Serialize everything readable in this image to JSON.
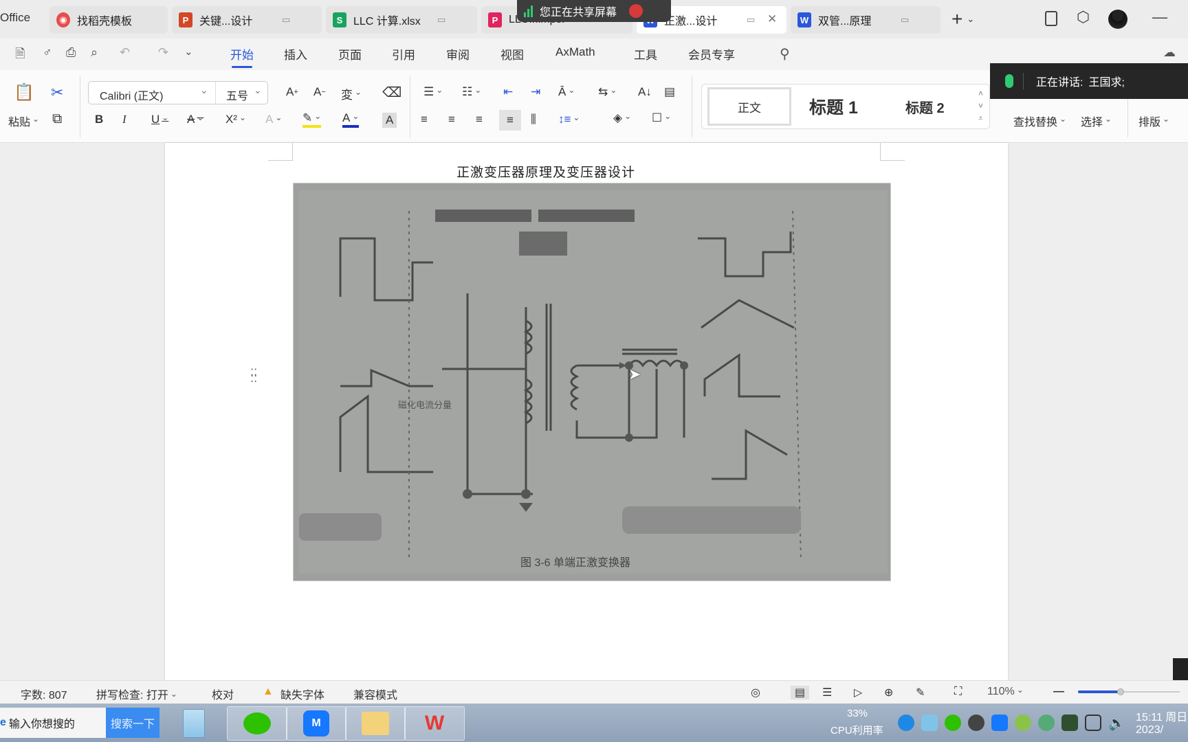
{
  "tabs": [
    {
      "label": "Office",
      "icon": "office-logo"
    },
    {
      "label": "找稻壳模板",
      "icon": "docer-icon",
      "color": "#e74c4c"
    },
    {
      "label": "关键...设计",
      "icon": "ppt-icon",
      "icon_text": "P",
      "color": "#d24726"
    },
    {
      "label": "LLC 计算.xlsx",
      "icon": "excel-icon",
      "icon_text": "S",
      "color": "#1aa260"
    },
    {
      "label": "LLC...impor",
      "icon": "pdf-icon",
      "icon_text": "P",
      "color": "#e0245e"
    },
    {
      "label": "正激...设计",
      "icon": "word-icon",
      "icon_text": "W",
      "color": "#2b57d9",
      "active": true
    },
    {
      "label": "双管...原理",
      "icon": "word-icon",
      "icon_text": "W",
      "color": "#2b57d9"
    }
  ],
  "share_popup": {
    "label": "您正在共享屏幕"
  },
  "window_controls": {
    "minimize": "—"
  },
  "menu": {
    "items": [
      "开始",
      "插入",
      "页面",
      "引用",
      "审阅",
      "视图",
      "AxMath",
      "工具",
      "会员专享"
    ],
    "active": "开始"
  },
  "ribbon": {
    "paste_label": "粘贴",
    "font_name": "Calibri (正文)",
    "font_size": "五号",
    "styles": [
      "正文",
      "标题 1",
      "标题 2"
    ],
    "find_replace": "查找替换",
    "select": "选择",
    "layout": "排版"
  },
  "speaking": {
    "label": "正在讲话:",
    "name": "王国求;"
  },
  "document": {
    "title": "正激变压器原理及变压器设计",
    "figure_caption": "图 3-6  单端正激变换器",
    "figure_annotation": "磁化电流分量"
  },
  "statusbar": {
    "word_count": "字数: 807",
    "spell_check": "拼写检查: 打开",
    "proofread": "校对",
    "missing_font": "缺失字体",
    "compat_mode": "兼容模式",
    "zoom": "110%",
    "zoom_fraction": 0.42
  },
  "taskbar": {
    "search_placeholder": "输入你想搜的",
    "search_button": "搜索一下",
    "cpu_percent": "33%",
    "cpu_label": "CPU利用率",
    "time": "15:11 周日",
    "date": "2023/"
  }
}
